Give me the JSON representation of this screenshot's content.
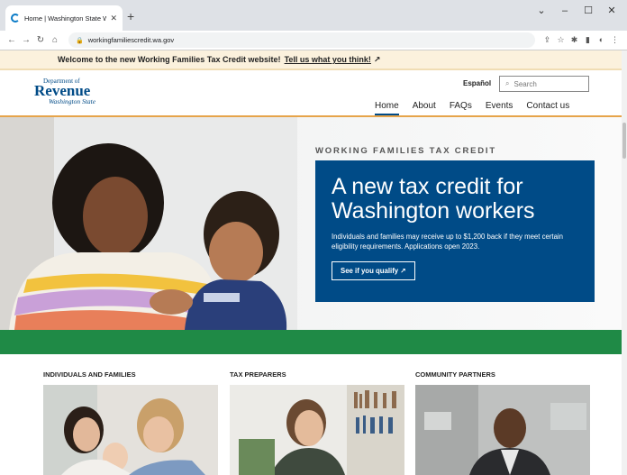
{
  "browser": {
    "tab_title": "Home | Washington State Worki",
    "url": "workingfamiliescredit.wa.gov"
  },
  "banner": {
    "text": "Welcome to the new Working Families Tax Credit website!",
    "link": "Tell us what you think!"
  },
  "header": {
    "logo_line1": "Department of",
    "logo_line2": "Revenue",
    "logo_line3": "Washington State",
    "language": "Español",
    "search_placeholder": "Search",
    "nav": [
      "Home",
      "About",
      "FAQs",
      "Events",
      "Contact us"
    ]
  },
  "hero": {
    "eyebrow": "WORKING FAMILIES TAX CREDIT",
    "title": "A new tax credit for Washington workers",
    "body": "Individuals and families may receive up to $1,200 back if they meet certain eligibility requirements. Applications open 2023.",
    "cta": "See if you qualify"
  },
  "cards": [
    {
      "title": "INDIVIDUALS AND FAMILIES"
    },
    {
      "title": "TAX PREPARERS"
    },
    {
      "title": "COMMUNITY PARTNERS"
    }
  ],
  "colors": {
    "brand_blue": "#004b87",
    "green_bar": "#1f8a46",
    "banner_bg": "#fbf1dd",
    "accent_orange": "#e6a44a"
  }
}
